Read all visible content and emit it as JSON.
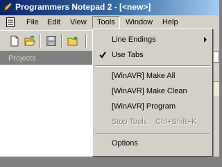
{
  "window": {
    "title": "Programmers Notepad 2 - [<new>]"
  },
  "menubar": {
    "items": [
      {
        "label": "File"
      },
      {
        "label": "Edit"
      },
      {
        "label": "View"
      },
      {
        "label": "Tools"
      },
      {
        "label": "Window"
      },
      {
        "label": "Help"
      }
    ]
  },
  "toolbar": {
    "buttons": [
      "new-file-icon",
      "open-folder-icon",
      "save-icon",
      "open-project-icon"
    ]
  },
  "projects": {
    "header": "Projects"
  },
  "tools_menu": {
    "items": [
      {
        "label": "Line Endings",
        "submenu": true
      },
      {
        "label": "Use Tabs",
        "checked": true
      },
      {
        "label": "[WinAVR] Make All"
      },
      {
        "label": "[WinAVR] Make Clean"
      },
      {
        "label": "[WinAVR] Program"
      },
      {
        "label": "Stop Tools",
        "shortcut": "Ctrl+Shift+K",
        "disabled": true
      },
      {
        "label": "Options"
      }
    ]
  },
  "colors": {
    "title_start": "#0a246a",
    "title_end": "#a6caf0",
    "menu_bg": "#d4d0c8",
    "disabled_text": "#808080"
  }
}
